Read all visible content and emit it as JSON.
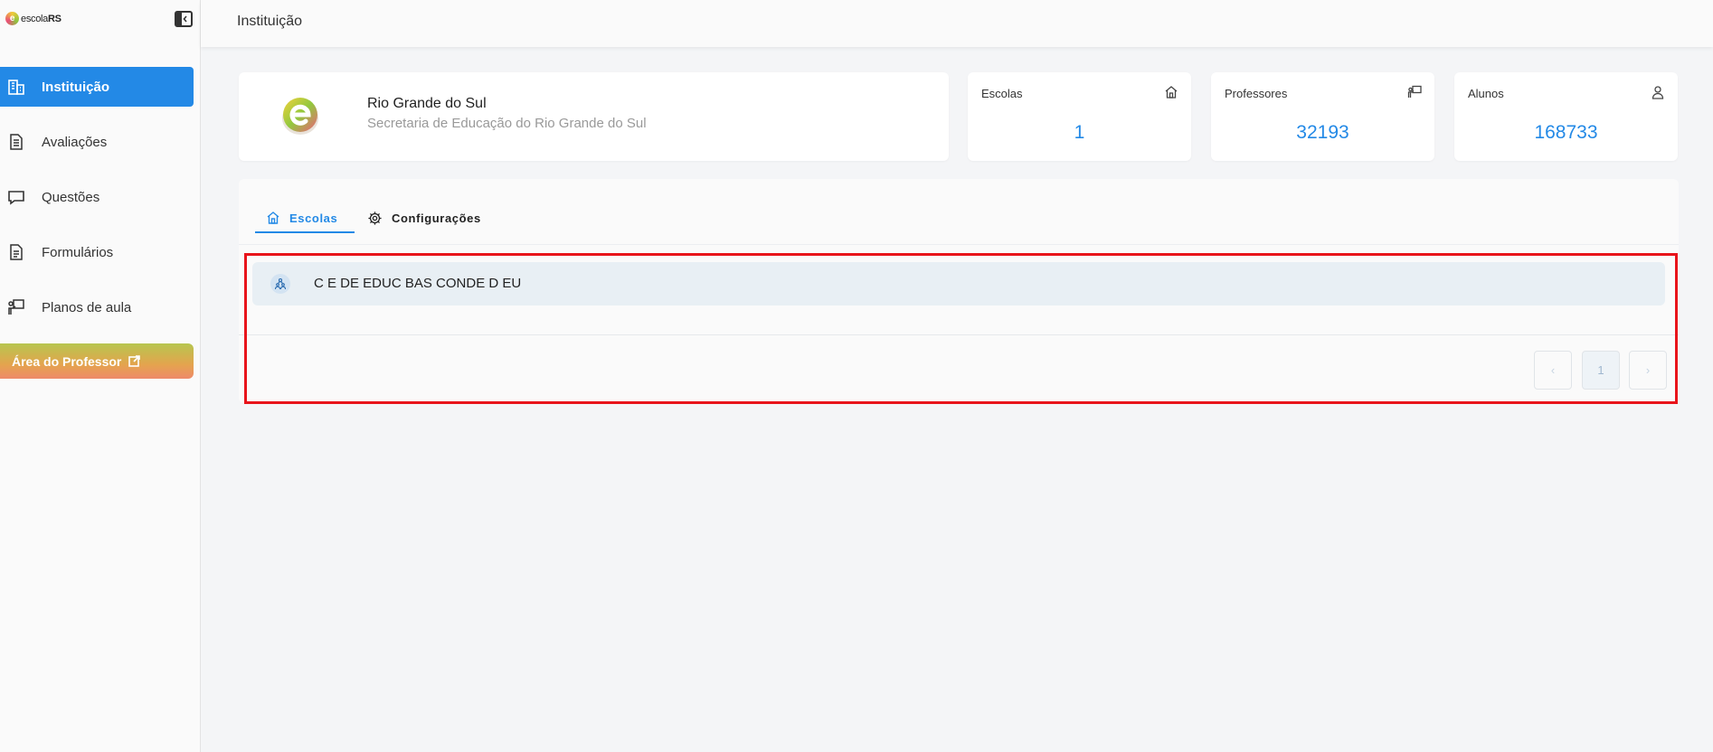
{
  "app": {
    "logo_text_light": "escola",
    "logo_text_bold": "RS",
    "logo_letter": "e"
  },
  "header": {
    "title": "Instituição"
  },
  "sidebar": {
    "items": [
      {
        "label": "Instituição",
        "icon": "building-icon",
        "active": true
      },
      {
        "label": "Avaliações",
        "icon": "document-icon",
        "active": false
      },
      {
        "label": "Questões",
        "icon": "chat-icon",
        "active": false
      },
      {
        "label": "Formulários",
        "icon": "form-icon",
        "active": false
      },
      {
        "label": "Planos de aula",
        "icon": "teacher-board-icon",
        "active": false
      }
    ],
    "professor_button": "Área do Professor"
  },
  "institution": {
    "name": "Rio Grande do Sul",
    "subtitle": "Secretaria de Educação do Rio Grande do Sul"
  },
  "stats": [
    {
      "label": "Escolas",
      "value": "1",
      "icon": "school-icon"
    },
    {
      "label": "Professores",
      "value": "32193",
      "icon": "teacher-board-icon"
    },
    {
      "label": "Alunos",
      "value": "168733",
      "icon": "user-icon"
    }
  ],
  "tabs": [
    {
      "label": "Escolas",
      "icon": "home-icon",
      "active": true
    },
    {
      "label": "Configurações",
      "icon": "gear-icon",
      "active": false
    }
  ],
  "schools": [
    {
      "name": "C E DE EDUC BAS CONDE D EU",
      "icon": "school-group-icon"
    }
  ],
  "pagination": {
    "current_page": "1",
    "prev": "‹",
    "next": "›"
  },
  "colors": {
    "accent": "#2389e6",
    "highlight": "#e8141b"
  }
}
